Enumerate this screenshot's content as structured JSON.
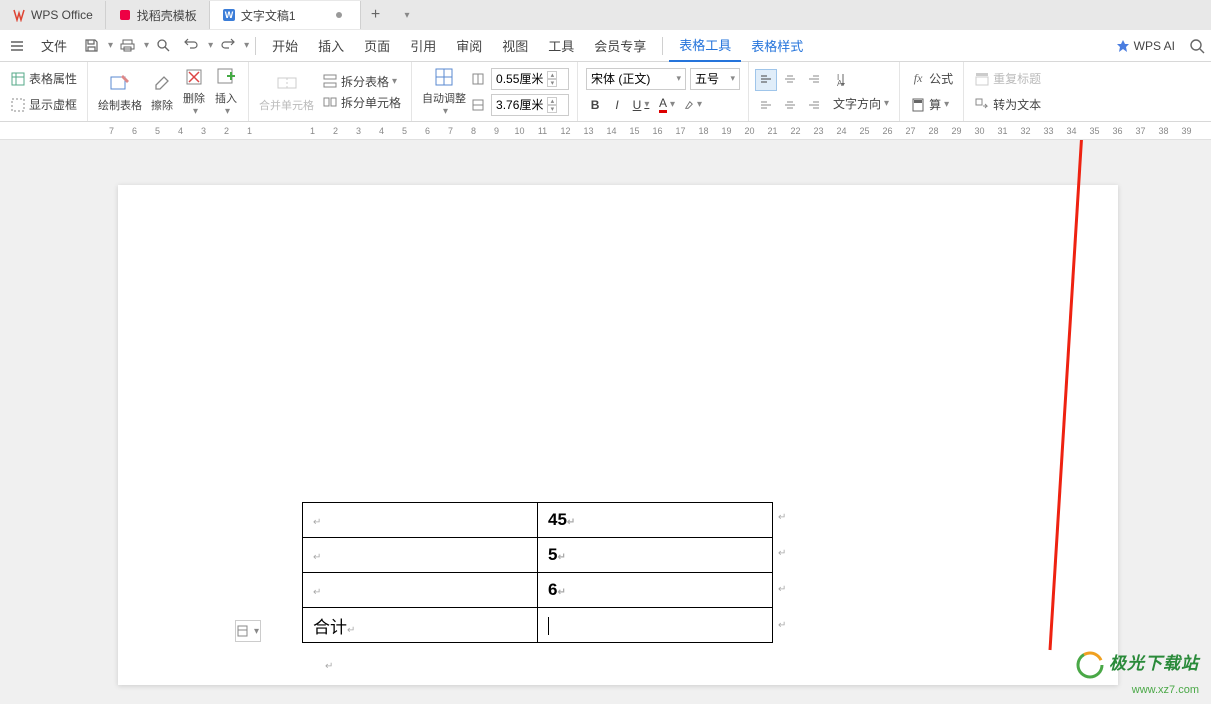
{
  "tabs": {
    "office_label": "WPS Office",
    "template_label": "找稻壳模板",
    "doc_label": "文字文稿1"
  },
  "menu": {
    "file": "文件",
    "start": "开始",
    "insert": "插入",
    "page": "页面",
    "reference": "引用",
    "review": "审阅",
    "view": "视图",
    "tools": "工具",
    "member": "会员专享",
    "table_tools": "表格工具",
    "table_style": "表格样式",
    "wps_ai": "WPS AI"
  },
  "ribbon": {
    "table_props": "表格属性",
    "show_frame": "显示虚框",
    "draw_table": "绘制表格",
    "erase": "擦除",
    "delete": "删除",
    "insert": "插入",
    "merge_cells": "合并单元格",
    "split_table": "拆分表格",
    "split_cells": "拆分单元格",
    "auto_adjust": "自动调整",
    "row_height": "0.55厘米",
    "col_width": "3.76厘米",
    "font_name": "宋体 (正文)",
    "font_size": "五号",
    "text_dir": "文字方向",
    "formula": "公式",
    "calc": "算",
    "repeat_title": "重复标题",
    "to_text": "转为文本"
  },
  "ruler": {
    "left": [
      "7",
      "6",
      "5",
      "4",
      "3",
      "2",
      "1"
    ],
    "right": [
      "1",
      "2",
      "3",
      "4",
      "5",
      "6",
      "7",
      "8",
      "9",
      "10",
      "11",
      "12",
      "13",
      "14",
      "15",
      "16",
      "17",
      "18",
      "19",
      "20",
      "21",
      "22",
      "23",
      "24",
      "25",
      "26",
      "27",
      "28",
      "29",
      "30",
      "31",
      "32",
      "33",
      "34",
      "35",
      "36",
      "37",
      "38",
      "39"
    ]
  },
  "table": {
    "r1c2": "45",
    "r2c2": "5",
    "r3c2": "6",
    "r4c1": "合计"
  },
  "watermark": {
    "line1": "极光下载站",
    "line2": "www.xz7.com"
  }
}
